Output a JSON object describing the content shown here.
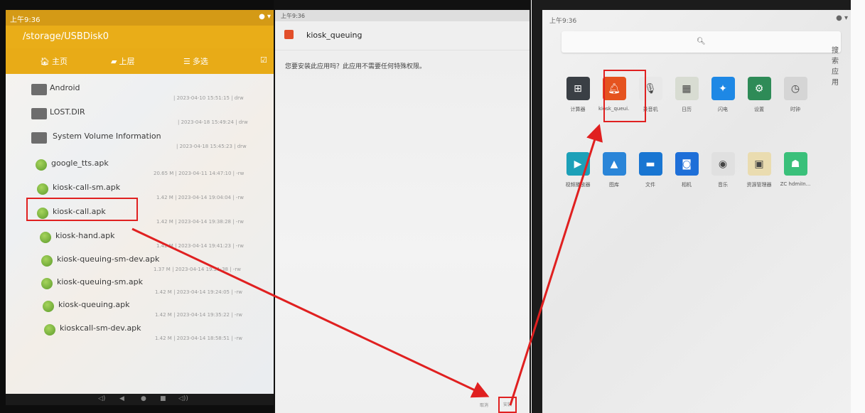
{
  "panel1": {
    "status_time": "上午9:36",
    "path": "/storage/USBDisk0",
    "toolbar": {
      "home": "主页",
      "up": "上层",
      "multi": "多选"
    },
    "items": [
      {
        "name": "Android",
        "meta": "| 2023-04-10 15:51:15 | drw",
        "kind": "folder"
      },
      {
        "name": "LOST.DIR",
        "meta": "| 2023-04-18 15:49:24 | drw",
        "kind": "folder"
      },
      {
        "name": "System Volume Information",
        "meta": "| 2023-04-18 15:45:23 | drw",
        "kind": "folder"
      },
      {
        "name": "google_tts.apk",
        "meta": "20.65 M | 2023-04-11 14:47:10 | -rw",
        "kind": "apk"
      },
      {
        "name": "kiosk-call-sm.apk",
        "meta": "1.42 M | 2023-04-14 19:04:04 | -rw",
        "kind": "apk"
      },
      {
        "name": "kiosk-call.apk",
        "meta": "1.42 M | 2023-04-14 19:38:28 | -rw",
        "kind": "apk"
      },
      {
        "name": "kiosk-hand.apk",
        "meta": "1.42 M | 2023-04-14 19:41:23 | -rw",
        "kind": "apk"
      },
      {
        "name": "kiosk-queuing-sm-dev.apk",
        "meta": "1.37 M | 2023-04-14 19:21:38 | -rw",
        "kind": "apk"
      },
      {
        "name": "kiosk-queuing-sm.apk",
        "meta": "1.42 M | 2023-04-14 19:24:05 | -rw",
        "kind": "apk"
      },
      {
        "name": "kiosk-queuing.apk",
        "meta": "1.42 M | 2023-04-14 19:35:22 | -rw",
        "kind": "apk"
      },
      {
        "name": "kioskcall-sm-dev.apk",
        "meta": "1.42 M | 2023-04-14 18:58:51 | -rw",
        "kind": "apk"
      }
    ]
  },
  "panel2": {
    "status_time": "上午9:36",
    "app_title": "kiosk_queuing",
    "message": "您要安装此应用吗？此应用不需要任何特殊权限。",
    "cancel_label": "取消",
    "install_label": "安装"
  },
  "panel3": {
    "status_time": "上午9:36",
    "search_placeholder": "搜索应用",
    "row1": [
      {
        "label": "计算器",
        "icon": "calculator-icon",
        "color": "#3a3f45"
      },
      {
        "label": "kiosk_queui...",
        "icon": "bell-icon",
        "color": "#e5531f"
      },
      {
        "label": "录音机",
        "icon": "mic-icon",
        "color": "#e8e8e8"
      },
      {
        "label": "日历",
        "icon": "calendar-icon",
        "color": "#d8dcd2"
      },
      {
        "label": "闪电",
        "icon": "compass-icon",
        "color": "#1e88e5"
      },
      {
        "label": "设置",
        "icon": "gear-icon",
        "color": "#2e8b57"
      },
      {
        "label": "时钟",
        "icon": "clock-icon",
        "color": "#d5d5d5"
      }
    ],
    "row2": [
      {
        "label": "视频播放器",
        "icon": "play-icon",
        "color": "#1ca0b8"
      },
      {
        "label": "图库",
        "icon": "gallery-icon",
        "color": "#2a85d8"
      },
      {
        "label": "文件",
        "icon": "folder-icon",
        "color": "#1976d2"
      },
      {
        "label": "相机",
        "icon": "camera-icon",
        "color": "#1e6fd8"
      },
      {
        "label": "音乐",
        "icon": "music-icon",
        "color": "#e0e0e0"
      },
      {
        "label": "资源管理器",
        "icon": "explorer-icon",
        "color": "#eadcb0"
      },
      {
        "label": "ZC hdmiIn...",
        "icon": "android-icon",
        "color": "#3ac07a"
      }
    ]
  },
  "colors": {
    "highlight": "#e02020",
    "toolbar": "#e8ab17"
  }
}
